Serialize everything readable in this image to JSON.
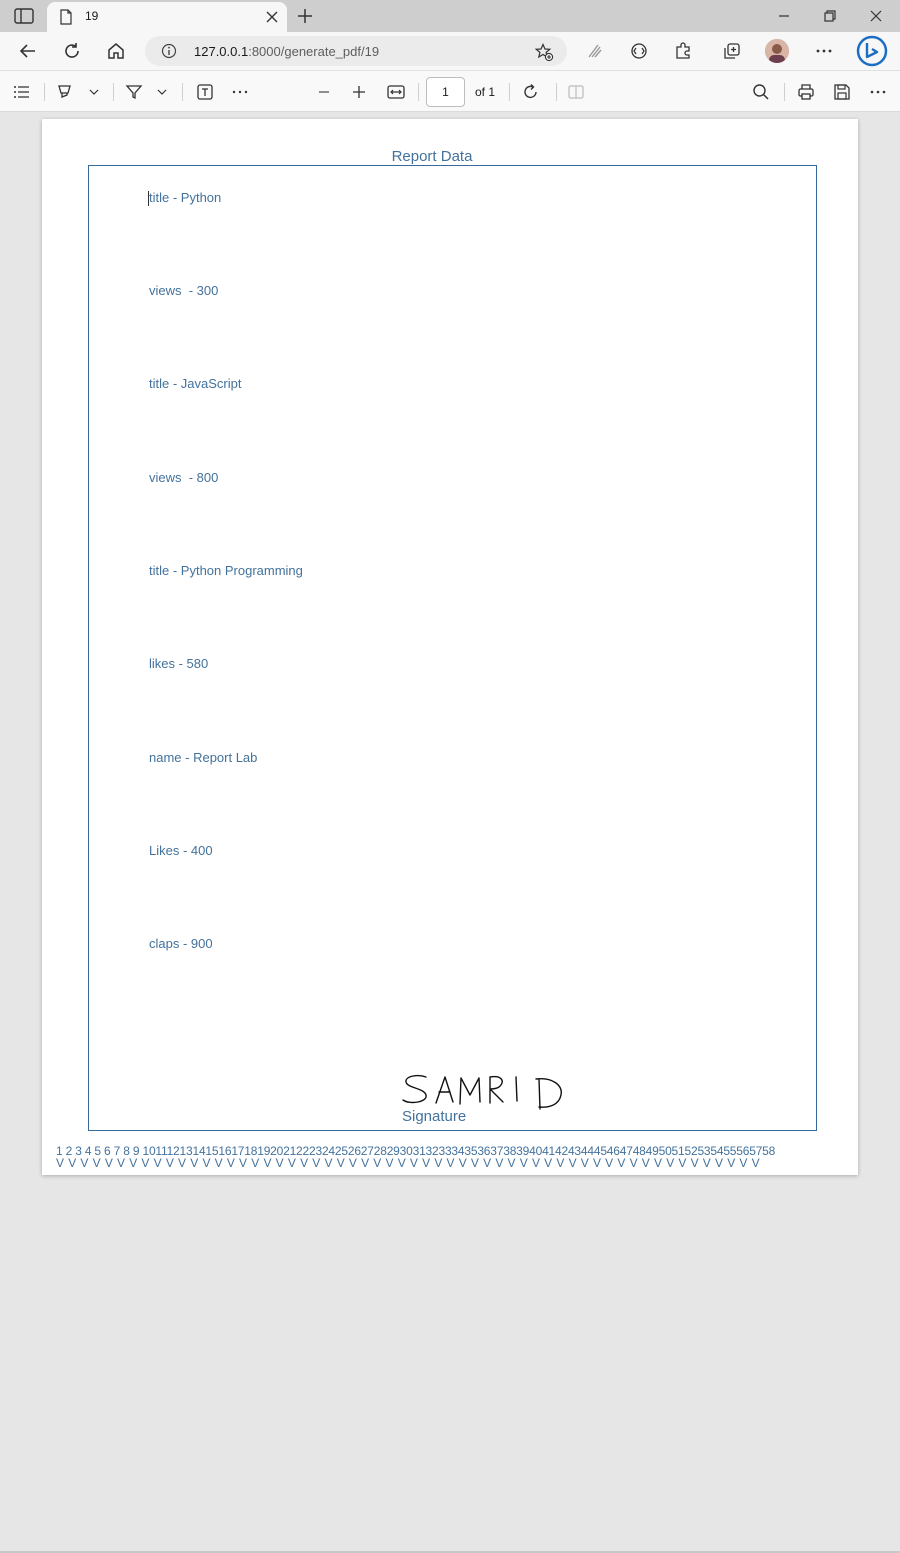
{
  "browser": {
    "tab_title": "19",
    "url_host": "127.0.0.1",
    "url_path": ":8000/generate_pdf/19"
  },
  "pdf_toolbar": {
    "page_number": "1",
    "page_of": "of 1"
  },
  "document": {
    "title": "Report Data",
    "entries": [
      "title - Python",
      "views  - 300",
      "title - JavaScript",
      "views  - 800",
      "title - Python Programming",
      "likes - 580",
      "name - Report Lab",
      "Likes - 400",
      "claps - 900"
    ],
    "signature_handwriting": "SAMRID",
    "signature_label": "Signature",
    "footer_numbers": "1  2  3  4  5  6  7  8  9  10111213141516171819202122232425262728293031323334353637383940414243444546474849505152535455565758",
    "footer_v": "VVVVVVVVVVVVVVVVVVVVVVVVVVVVVVVVVVVVVVVVVVVVVVVVVVVVVVVVVV"
  },
  "colors": {
    "doc_text": "#43729c",
    "border": "#37699a",
    "viewer_bg": "#e6e6e6"
  }
}
